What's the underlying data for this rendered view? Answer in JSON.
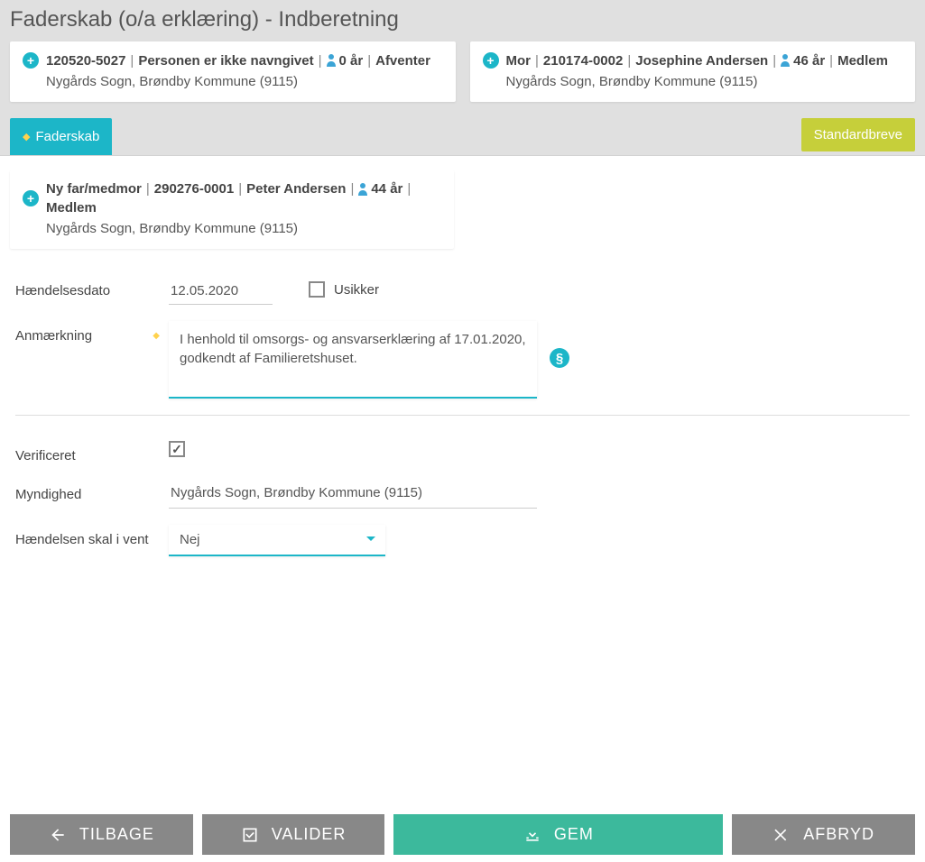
{
  "title": "Faderskab (o/a erklæring) - Indberetning",
  "child_card": {
    "cpr": "120520-5027",
    "name": "Personen er ikke navngivet",
    "age": "0 år",
    "status": "Afventer",
    "parish": "Nygårds Sogn, Brøndby Kommune (9115)"
  },
  "mother_card": {
    "role": "Mor",
    "cpr": "210174-0002",
    "name": "Josephine Andersen",
    "age": "46 år",
    "status": "Medlem",
    "parish": "Nygårds Sogn, Brøndby Kommune (9115)"
  },
  "father_card": {
    "role": "Ny far/medmor",
    "cpr": "290276-0001",
    "name": "Peter Andersen",
    "age": "44 år",
    "status": "Medlem",
    "parish": "Nygårds Sogn, Brøndby Kommune (9115)"
  },
  "tab": {
    "label": "Faderskab"
  },
  "standard_letters": "Standardbreve",
  "form": {
    "event_date_label": "Hændelsesdato",
    "event_date": "12.05.2020",
    "uncertain_label": "Usikker",
    "uncertain_checked": false,
    "remark_label": "Anmærkning",
    "remark": "I henhold til omsorgs- og ansvarserklæring af 17.01.2020, godkendt af Familieretshuset.",
    "verified_label": "Verificeret",
    "verified_checked": true,
    "authority_label": "Myndighed",
    "authority": "Nygårds Sogn, Brøndby Kommune (9115)",
    "pending_label": "Hændelsen skal i vent",
    "pending_value": "Nej"
  },
  "footer": {
    "back": "TILBAGE",
    "validate": "VALIDER",
    "save": "GEM",
    "cancel": "AFBRYD"
  }
}
